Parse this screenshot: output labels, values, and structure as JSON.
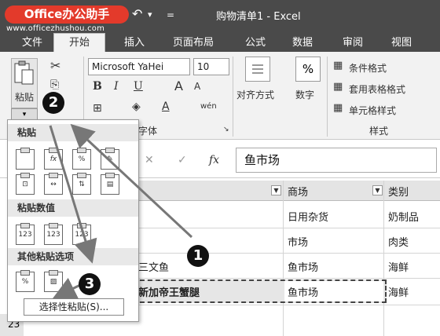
{
  "brand": {
    "label": "Office办公助手",
    "url": "www.officezhushou.com"
  },
  "window": {
    "title": "购物清单1 - Excel"
  },
  "qat": {
    "undo": "↶",
    "more": "="
  },
  "tabs": [
    "文件",
    "开始",
    "插入",
    "页面布局",
    "公式",
    "数据",
    "审阅",
    "视图"
  ],
  "ribbon": {
    "paste_label": "粘贴",
    "font_name": "Microsoft YaHei",
    "font_size": "10",
    "font_group": "字体",
    "align_label": "对齐方式",
    "number_label": "数字",
    "number_symbol": "%",
    "styles": [
      "条件格式",
      "套用表格格式",
      "单元格样式"
    ],
    "styles_group": "样式",
    "bold": "B",
    "italic": "I",
    "underline": "U",
    "grow": "A",
    "shrink": "A",
    "fontcolor": "A",
    "phonetic": "wén"
  },
  "formula": {
    "fx": "fx",
    "cancel": "✕",
    "enter": "✓",
    "value": "鱼市场"
  },
  "columns": [
    "商场",
    "类别"
  ],
  "rows": [
    {
      "a": "",
      "b": "日用杂货",
      "c": "奶制品"
    },
    {
      "a": "",
      "b": "市场",
      "c": "肉类"
    },
    {
      "a": "三文鱼",
      "b": "鱼市场",
      "c": "海鲜"
    },
    {
      "a": "新加帝王蟹腿",
      "b": "鱼市场",
      "c": "海鲜"
    }
  ],
  "row_number": "23",
  "paste_panel": {
    "section1": "粘贴",
    "section2": "粘贴数值",
    "section3": "其他粘贴选项",
    "paste_special": "选择性粘贴(S)...",
    "value_icon_label": "123"
  },
  "badges": [
    "1",
    "2",
    "3"
  ],
  "colors": {
    "brand": "#e33a2b",
    "titlebar": "#4a4a4a",
    "ribbon": "#f2f2f2",
    "panel_section": "#e8e8e8"
  }
}
